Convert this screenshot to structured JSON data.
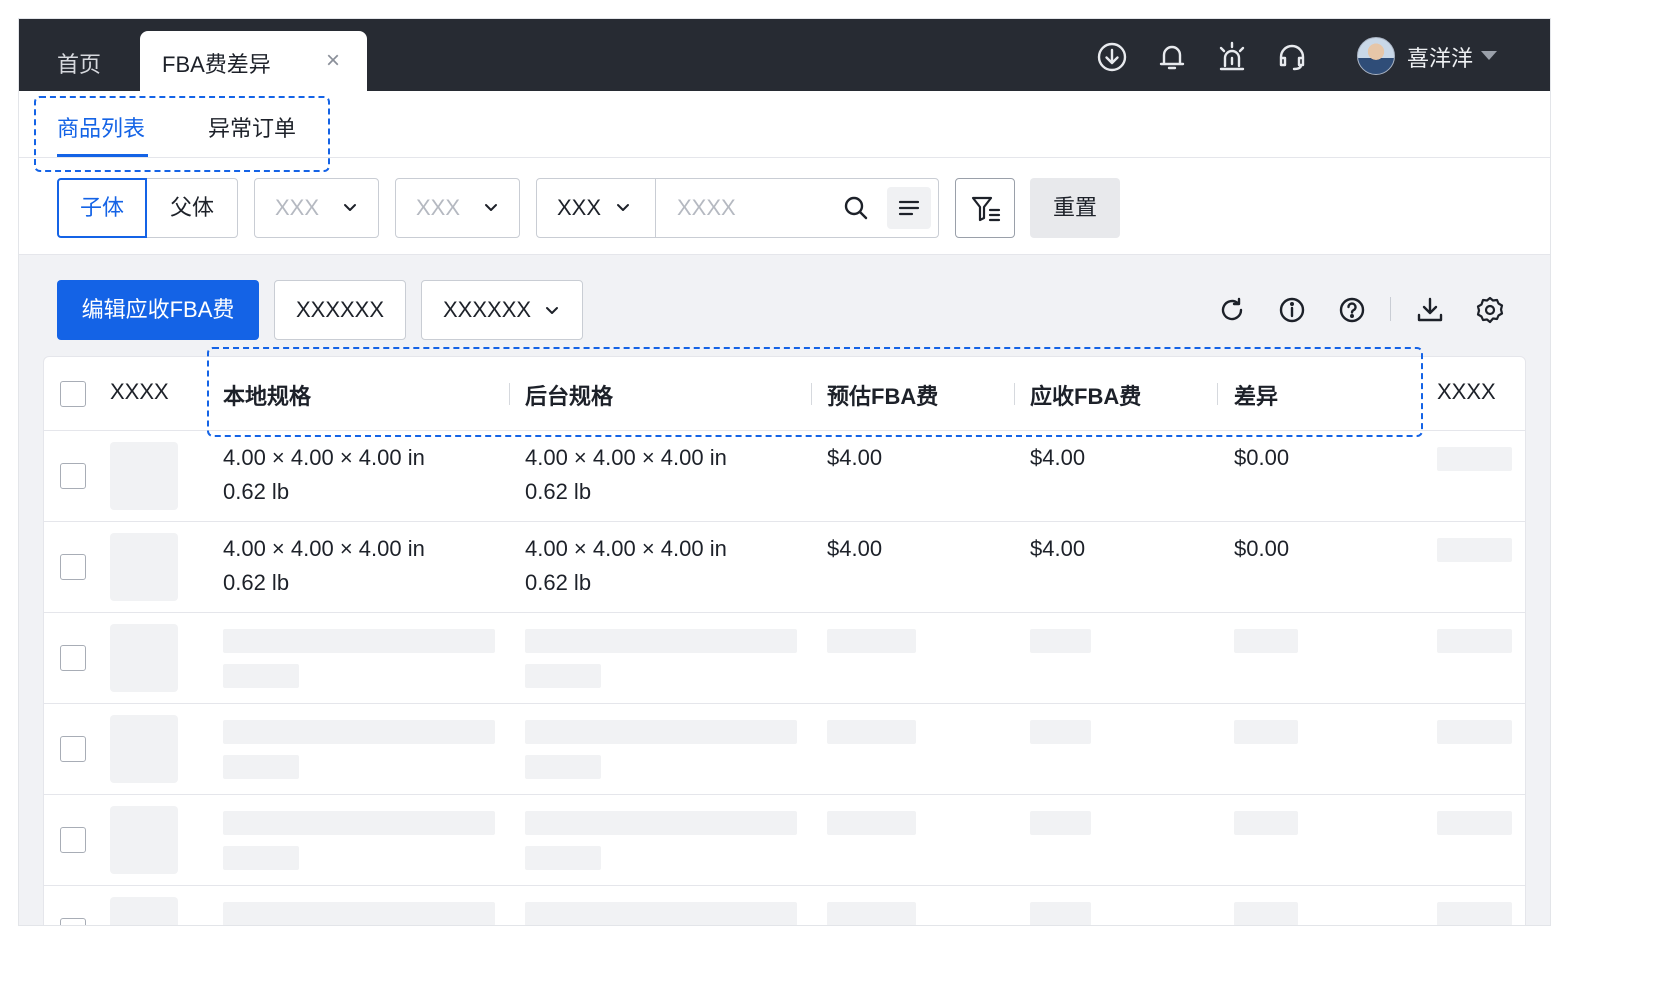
{
  "tabs": {
    "home": "首页",
    "active": "FBA费差异",
    "close": "×"
  },
  "header": {
    "icons": [
      "download-circle-icon",
      "bell-icon",
      "alarm-light-icon",
      "headset-icon"
    ],
    "username": "喜洋洋"
  },
  "subtabs": {
    "items": [
      "商品列表",
      "异常订单"
    ],
    "active_index": 0
  },
  "filters": {
    "toggle": [
      "子体",
      "父体"
    ],
    "select1_placeholder": "XXX",
    "select2_placeholder": "XXX",
    "search_type": "XXX",
    "search_placeholder": "XXXX",
    "reset": "重置"
  },
  "toolbar": {
    "primary": "编辑应收FBA费",
    "button2": "XXXXXX",
    "dropdown": "XXXXXX",
    "icons": [
      "refresh-icon",
      "info-icon",
      "help-icon",
      "download-icon",
      "settings-icon"
    ]
  },
  "table": {
    "columns": [
      "XXXX",
      "本地规格",
      "后台规格",
      "预估FBA费",
      "应收FBA费",
      "差异",
      "XXXX"
    ],
    "rows": [
      {
        "local_dims": "4.00 × 4.00 × 4.00 in",
        "local_weight": "0.62 lb",
        "backend_dims": "4.00 × 4.00 × 4.00 in",
        "backend_weight": "0.62 lb",
        "est_fee": "$4.00",
        "recv_fee": "$4.00",
        "diff": "$0.00"
      },
      {
        "local_dims": "4.00 × 4.00 × 4.00 in",
        "local_weight": "0.62 lb",
        "backend_dims": "4.00 × 4.00 × 4.00 in",
        "backend_weight": "0.62 lb",
        "est_fee": "$4.00",
        "recv_fee": "$4.00",
        "diff": "$0.00"
      }
    ]
  },
  "colors": {
    "topbar": "#272b33",
    "accent": "#1463e6",
    "background": "#f1f2f5"
  }
}
